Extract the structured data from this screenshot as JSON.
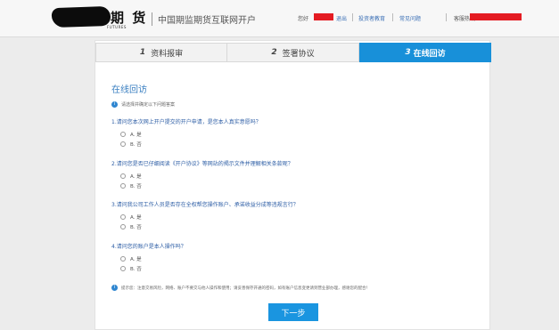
{
  "header": {
    "logo_text": "期 货",
    "logo_subtext": "FUTURES",
    "site_title": "中国期监期货互联网开户",
    "greeting": "您好",
    "logout": "退出",
    "investor_education": "投资者教育",
    "faq": "常见问题",
    "hotline": "客服热线",
    "redact_color": "#e41b22"
  },
  "steps": [
    {
      "num": "1",
      "label": "资料报审"
    },
    {
      "num": "2",
      "label": "签署协议"
    },
    {
      "num": "3",
      "label": "在线回访"
    }
  ],
  "content": {
    "title": "在线回访",
    "notice": "请选择并确定以下问题答案",
    "questions": [
      {
        "text": "1.请问您本次网上开户提交的开户申请，是您本人真实意愿吗？",
        "options": [
          "A. 是",
          "B. 否"
        ]
      },
      {
        "text": "2.请问您是否已仔细阅读《开户协议》等网站的揭示文件并理解相关条款呢？",
        "options": [
          "A. 是",
          "B. 否"
        ]
      },
      {
        "text": "3.请问我公司工作人员是否存在全权帮您操作账户、承诺收益分成等违规言行？",
        "options": [
          "A. 是",
          "B. 否"
        ]
      },
      {
        "text": "4.请问您的账户是本人操作吗？",
        "options": [
          "A. 是",
          "B. 否"
        ]
      }
    ],
    "bottom_note": "提示您：注意交易风险，网络、账户不要交与他人操作和使用；请妥善保存开通的密码，如有账户信息变更请到营业部办理，感谢您的配合！",
    "next_button": "下一步"
  },
  "colors": {
    "accent": "#1890d9",
    "link": "#3a6fb5",
    "question": "#2c5da5"
  }
}
